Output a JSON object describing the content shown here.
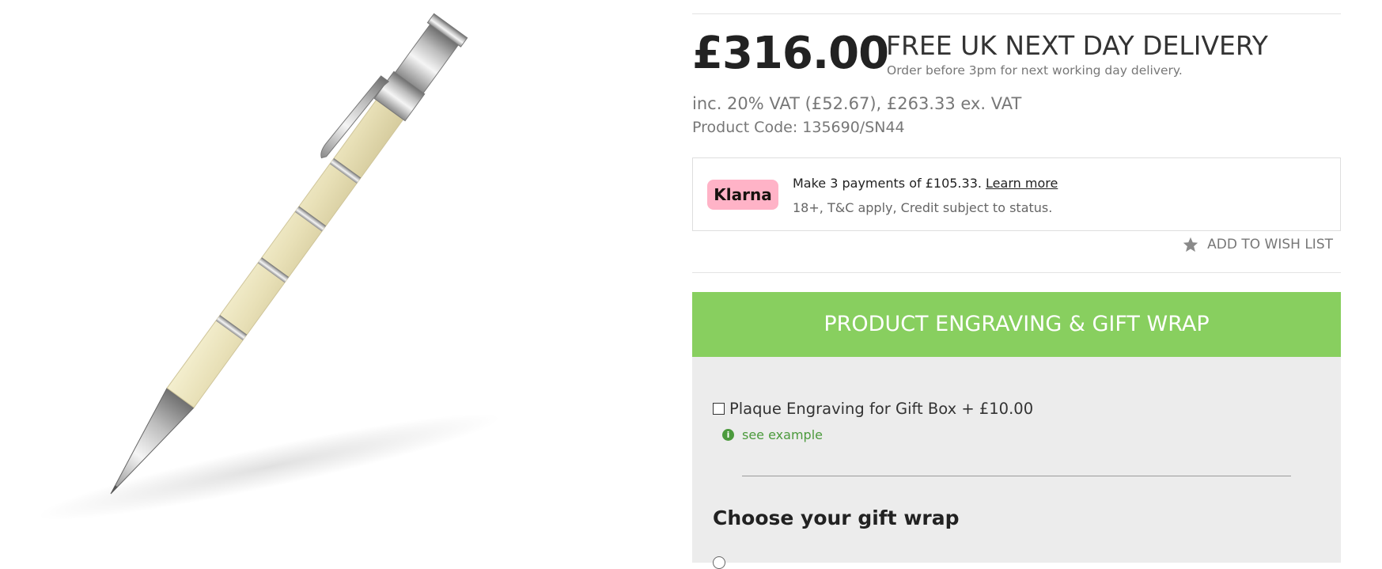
{
  "product": {
    "image_alt": "Ivory mechanical pencil with silver platinum-plated fittings",
    "price": "£316.00",
    "delivery_title": "FREE UK NEXT DAY DELIVERY",
    "delivery_note": "Order before 3pm for next working day delivery.",
    "vat_line": "inc. 20% VAT (£52.67), £263.33 ex. VAT",
    "product_code": "Product Code: 135690/SN44"
  },
  "klarna": {
    "badge": "Klarna",
    "payments_text": "Make 3 payments of £105.33.",
    "learn_more": "Learn more",
    "terms": "18+, T&C apply, Credit subject to status.",
    "badge_color": "#ffb3c7"
  },
  "wishlist": {
    "icon": "star-icon",
    "label": "ADD TO WISH LIST"
  },
  "engraving": {
    "header": "PRODUCT ENGRAVING & GIFT WRAP",
    "header_color": "#88cf5f",
    "option_label": "Plaque Engraving for Gift Box + £10.00",
    "option_checked": false,
    "see_example": "see example",
    "gift_wrap_title": "Choose your gift wrap"
  }
}
